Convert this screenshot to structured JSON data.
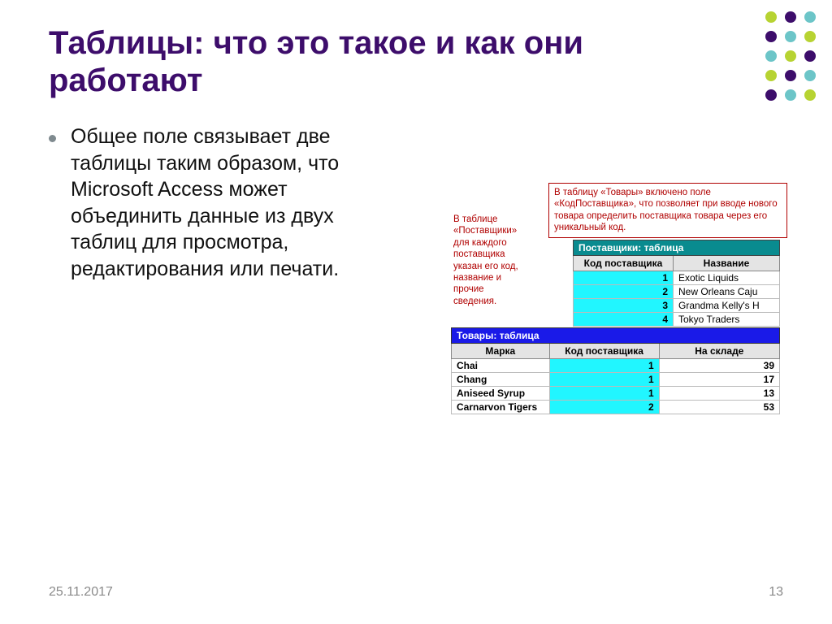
{
  "title": "Таблицы: что это такое и как они работают",
  "bullet": "Общее поле связывает две таблицы таким образом, что Microsoft Access может объединить данные из двух таблиц для просмотра, редактирования или печати.",
  "footer": {
    "date": "25.11.2017",
    "page": "13"
  },
  "diagram": {
    "callout_top": "В таблицу «Товары» включено поле «КодПоставщика», что позволяет при вводе нового товара определить поставщика товара через его уникальный код.",
    "callout_left": "В таблице «Поставщики» для каждого поставщика указан его код, название и прочие сведения.",
    "table1": {
      "title": "Поставщики: таблица",
      "headers": [
        "Код поставщика",
        "Название"
      ],
      "rows": [
        [
          "1",
          "Exotic Liquids"
        ],
        [
          "2",
          "New Orleans Caju"
        ],
        [
          "3",
          "Grandma Kelly's H"
        ],
        [
          "4",
          "Tokyo Traders"
        ]
      ]
    },
    "table2": {
      "title": "Товары: таблица",
      "headers": [
        "Марка",
        "Код поставщика",
        "На складе"
      ],
      "rows": [
        [
          "Chai",
          "1",
          "39"
        ],
        [
          "Chang",
          "1",
          "17"
        ],
        [
          "Aniseed Syrup",
          "1",
          "13"
        ],
        [
          "Carnarvon Tigers",
          "2",
          "53"
        ]
      ]
    }
  }
}
